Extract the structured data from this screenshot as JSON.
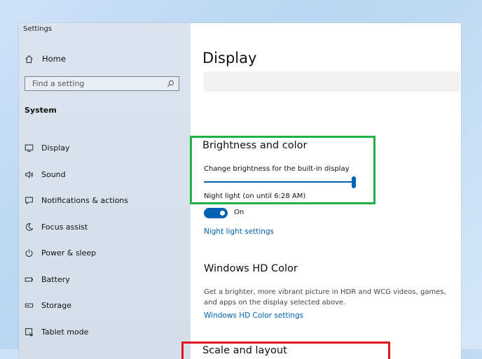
{
  "window": {
    "title": "Settings"
  },
  "sidebar": {
    "home_label": "Home",
    "search_placeholder": "Find a setting",
    "section_label": "System",
    "items": [
      {
        "label": "Display",
        "icon": "monitor-icon"
      },
      {
        "label": "Sound",
        "icon": "speaker-icon"
      },
      {
        "label": "Notifications & actions",
        "icon": "notification-icon"
      },
      {
        "label": "Focus assist",
        "icon": "moon-icon"
      },
      {
        "label": "Power & sleep",
        "icon": "power-icon"
      },
      {
        "label": "Battery",
        "icon": "battery-icon"
      },
      {
        "label": "Storage",
        "icon": "storage-icon"
      },
      {
        "label": "Tablet mode",
        "icon": "tablet-icon"
      }
    ]
  },
  "main": {
    "page_title": "Display",
    "brightness": {
      "heading": "Brightness and color",
      "slider_label": "Change brightness for the built-in display",
      "slider_value_percent": 100,
      "night_light_label": "Night light (on until 6:28 AM)",
      "toggle_state": "On",
      "night_light_link": "Night light settings"
    },
    "hdr": {
      "heading": "Windows HD Color",
      "description_line1": "Get a brighter, more vibrant picture in HDR and WCG videos, games,",
      "description_line2": "and apps on the display selected above.",
      "link": "Windows HD Color settings"
    },
    "scale": {
      "heading": "Scale and layout"
    }
  },
  "colors": {
    "accent": "#0063b1",
    "highlight_green": "#22b04a",
    "highlight_red": "#e0161e"
  }
}
